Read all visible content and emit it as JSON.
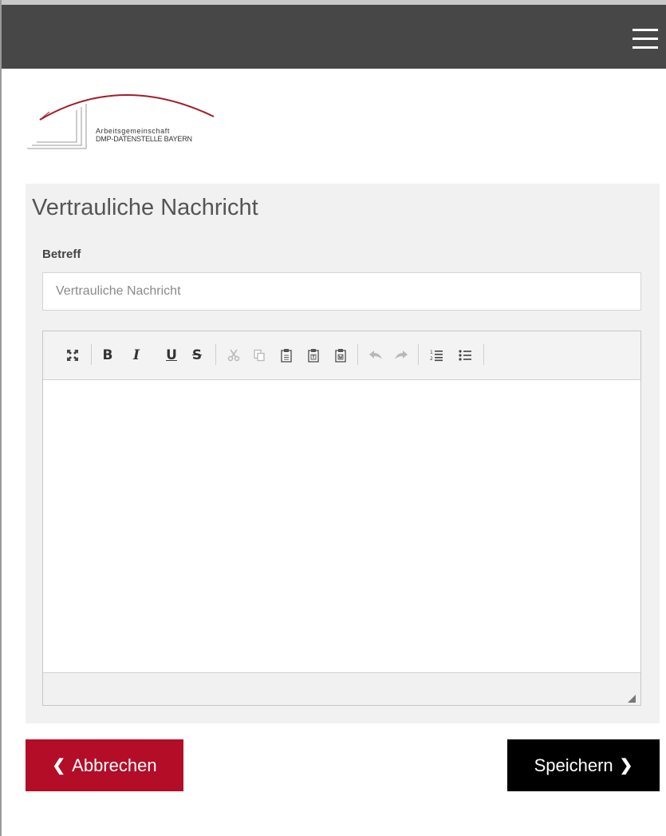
{
  "header": {
    "menu_icon": "hamburger-menu-icon"
  },
  "logo": {
    "line1": "Arbeitsgemeinschaft",
    "line2": "DMP-DATENSTELLE BAYERN",
    "accent_color": "#a01e2c"
  },
  "form": {
    "title": "Vertrauliche Nachricht",
    "subject_label": "Betreff",
    "subject_placeholder": "Vertrauliche Nachricht",
    "subject_value": ""
  },
  "editor": {
    "toolbar": [
      {
        "name": "maximize-icon",
        "enabled": true
      },
      {
        "name": "bold-icon",
        "label": "B",
        "enabled": true
      },
      {
        "name": "italic-icon",
        "label": "I",
        "enabled": true
      },
      {
        "name": "underline-icon",
        "label": "U",
        "enabled": true
      },
      {
        "name": "strikethrough-icon",
        "label": "S",
        "enabled": true
      },
      {
        "name": "cut-icon",
        "enabled": false
      },
      {
        "name": "copy-icon",
        "enabled": false
      },
      {
        "name": "paste-icon",
        "enabled": true
      },
      {
        "name": "paste-text-icon",
        "enabled": true
      },
      {
        "name": "paste-word-icon",
        "enabled": true
      },
      {
        "name": "undo-icon",
        "enabled": false
      },
      {
        "name": "redo-icon",
        "enabled": false
      },
      {
        "name": "numbered-list-icon",
        "enabled": true
      },
      {
        "name": "bulleted-list-icon",
        "enabled": true
      }
    ],
    "content": "",
    "resize_icon": "resize-handle-icon"
  },
  "actions": {
    "cancel_label": "Abbrechen",
    "save_label": "Speichern",
    "cancel_color": "#b30d27",
    "save_color": "#000000"
  }
}
